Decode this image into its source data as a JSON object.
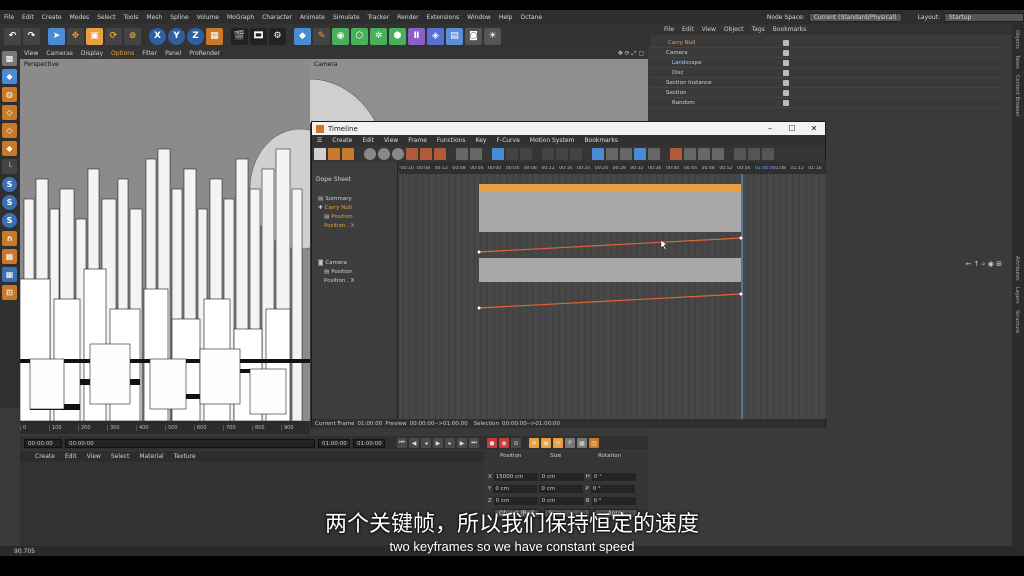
{
  "menu": {
    "items": [
      "File",
      "Edit",
      "Create",
      "Modes",
      "Select",
      "Tools",
      "Mesh",
      "Spline",
      "Volume",
      "MoGraph",
      "Character",
      "Animate",
      "Simulate",
      "Tracker",
      "Render",
      "Extensions",
      "Window",
      "Help",
      "Octane"
    ],
    "node_space_label": "Node Space:",
    "node_space_value": "Current (Standard/Physical)",
    "layout_label": "Layout:",
    "layout_value": "Startup"
  },
  "toolbar": {
    "axis_x": "X",
    "axis_y": "Y",
    "axis_z": "Z"
  },
  "left_tools": [
    "S",
    "S",
    "S"
  ],
  "viewport": {
    "menu": [
      "View",
      "Cameras",
      "Display",
      "Options",
      "Filter",
      "Panel",
      "ProRender"
    ],
    "label": "Perspective",
    "camera_label": "Camera"
  },
  "ruler": [
    "0",
    "100",
    "200",
    "300",
    "400",
    "500",
    "600",
    "700",
    "800",
    "900"
  ],
  "playback": {
    "current": "00:00:00",
    "start": "00:00:00",
    "end": "01:00:00",
    "end2": "01:00:00"
  },
  "material": {
    "menu": [
      "Create",
      "Edit",
      "View",
      "Select",
      "Material",
      "Texture"
    ]
  },
  "coordinates": {
    "headers": [
      "Position",
      "Size",
      "Rotation"
    ],
    "rows": [
      {
        "axis": "X",
        "pos": "15000 cm",
        "size": "0 cm",
        "rot_label": "H",
        "rot": "0 °"
      },
      {
        "axis": "Y",
        "pos": "0 cm",
        "size": "0 cm",
        "rot_label": "P",
        "rot": "0 °"
      },
      {
        "axis": "Z",
        "pos": "0 cm",
        "size": "0 cm",
        "rot_label": "B",
        "rot": "0 °"
      }
    ],
    "mode": "Object (Rel)",
    "size_mode": "Size",
    "apply": "Apply"
  },
  "status": "90.705",
  "object_manager": {
    "menu": [
      "File",
      "Edit",
      "View",
      "Object",
      "Tags",
      "Bookmarks"
    ],
    "rows": [
      {
        "label": "Carry Null",
        "color": "#e8a040"
      },
      {
        "label": "Camera",
        "color": "#d8d8d8"
      },
      {
        "label": "Landscape",
        "color": "#9fd0ff"
      },
      {
        "label": "Disc",
        "color": "#9fd0ff"
      },
      {
        "label": "Section Instance",
        "color": "#d8d8d8"
      },
      {
        "label": "Section",
        "color": "#d8d8d8"
      },
      {
        "label": "Random",
        "color": "#d8d8d8"
      }
    ]
  },
  "right_tabs": [
    "Objects",
    "Takes",
    "Content Browser",
    "Attributes",
    "Layers",
    "Structure"
  ],
  "timeline": {
    "title": "Timeline",
    "menu": [
      "Create",
      "Edit",
      "View",
      "Frame",
      "Functions",
      "Key",
      "F-Curve",
      "Motion System",
      "Bookmarks"
    ],
    "mode": "Dope Sheet",
    "ruler": [
      "-00:16",
      "00:08",
      "00:12",
      "00:08",
      "00:04",
      "00:00",
      "00:04",
      "00:08",
      "00:12",
      "00:16",
      "00:20",
      "00:24",
      "00:28",
      "00:32",
      "00:36",
      "00:40",
      "00:44",
      "00:48",
      "00:52",
      "00:56",
      "01:00:00",
      "01:08",
      "01:12",
      "01:16"
    ],
    "tracks": [
      {
        "label": "Summary",
        "indent": 0
      },
      {
        "label": "Carry Null",
        "indent": 1
      },
      {
        "label": "Position",
        "indent": 2
      },
      {
        "label": "Position . X",
        "indent": 3
      },
      {
        "label": "Camera",
        "indent": 1
      },
      {
        "label": "Position",
        "indent": 2
      },
      {
        "label": "Position . X",
        "indent": 3
      }
    ],
    "status": {
      "current_label": "Current Frame",
      "current": "01:00:00",
      "preview_label": "Preview",
      "preview": "00:00:00-->01:00:00",
      "selection_label": "Selection",
      "selection": "00:00:00-->01:00:00"
    }
  },
  "subtitles": {
    "cn": "两个关键帧，所以我们保持恒定的速度",
    "en": "two keyframes so we have constant speed"
  },
  "colors": {
    "accent": "#e8a040",
    "curve": "#e0663a",
    "blue_tool": "#4a8bd6"
  }
}
